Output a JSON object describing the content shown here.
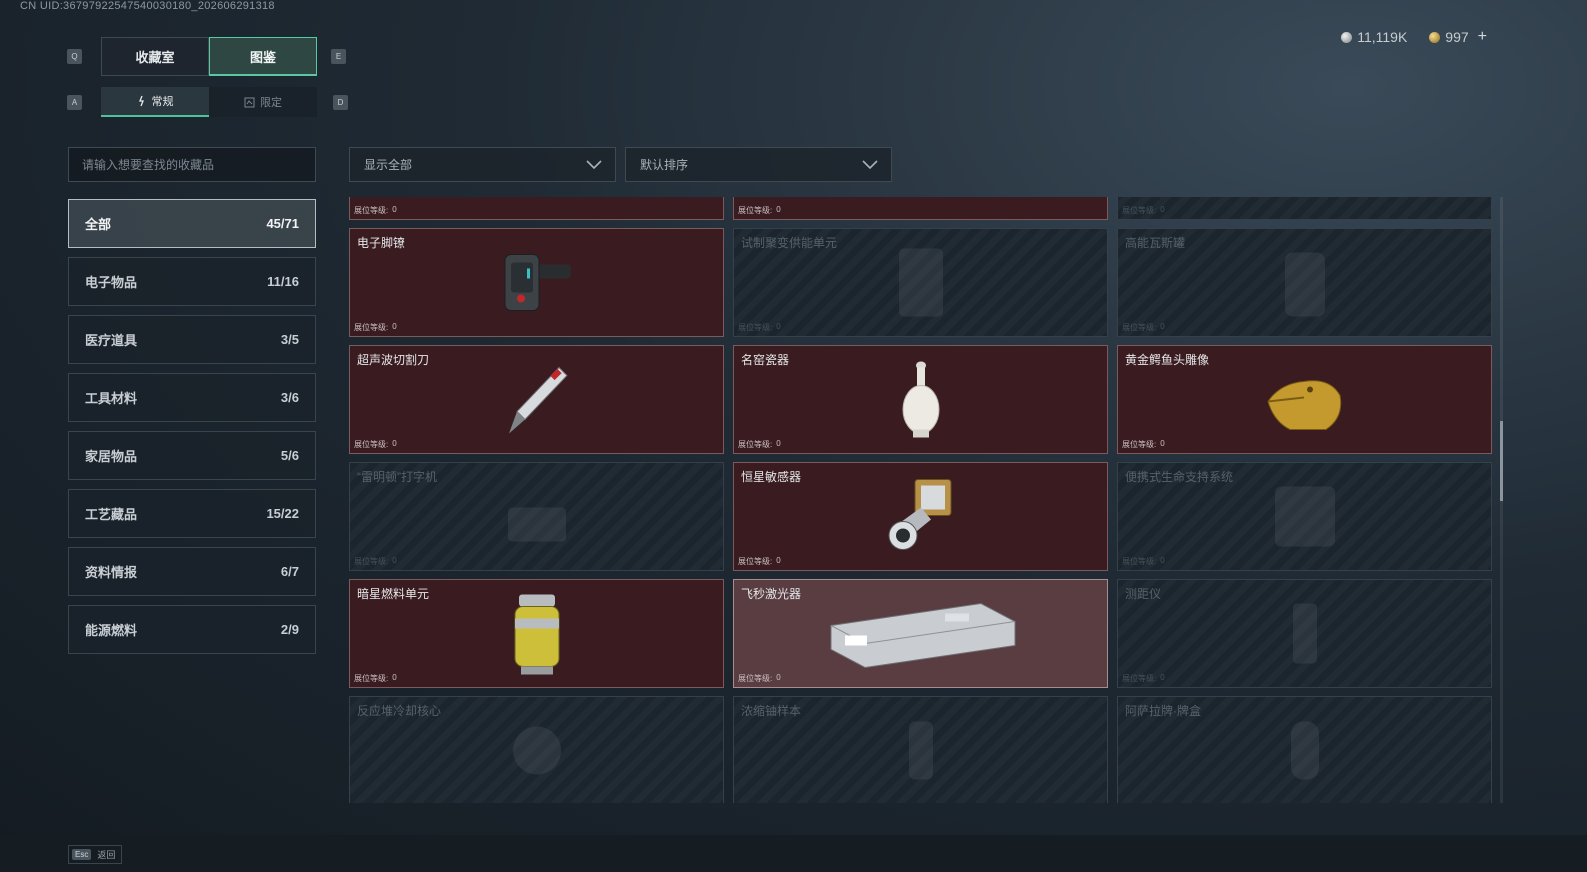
{
  "uid": "CN UID:3679792254754003018​0_202606291318",
  "currency": {
    "silver": "11,119K",
    "gold": "997",
    "plus": "+"
  },
  "keys": {
    "q": "Q",
    "e": "E",
    "a": "A",
    "d": "D"
  },
  "main_tabs": [
    "收藏室",
    "图鉴"
  ],
  "sub_tabs": [
    "常规",
    "限定"
  ],
  "search": {
    "placeholder": "请输入想要查找的收藏品"
  },
  "filter": {
    "display": "显示全部",
    "sort": "默认排序"
  },
  "categories": [
    {
      "label": "全部",
      "count": "45/71"
    },
    {
      "label": "电子物品",
      "count": "11/16"
    },
    {
      "label": "医疗道具",
      "count": "3/5"
    },
    {
      "label": "工具材料",
      "count": "3/6"
    },
    {
      "label": "家居物品",
      "count": "5/6"
    },
    {
      "label": "工艺藏品",
      "count": "15/22"
    },
    {
      "label": "资料情报",
      "count": "6/7"
    },
    {
      "label": "能源燃料",
      "count": "2/9"
    }
  ],
  "level_label": "展位等级:",
  "items": [
    {
      "name": "",
      "level": "0",
      "owned": true,
      "icon": "gold-device-icon"
    },
    {
      "name": "",
      "level": "0",
      "owned": true,
      "icon": "radio-device-icon"
    },
    {
      "name": "",
      "level": "0",
      "owned": false,
      "icon": "bronze-relic-icon"
    },
    {
      "name": "电子脚镣",
      "level": "0",
      "owned": true,
      "icon": "ankle-monitor-icon"
    },
    {
      "name": "试制聚变供能单元",
      "level": "0",
      "owned": false,
      "icon": "fusion-unit-icon"
    },
    {
      "name": "高能瓦斯罐",
      "level": "0",
      "owned": false,
      "icon": "gas-canister-icon"
    },
    {
      "name": "超声波切割刀",
      "level": "0",
      "owned": true,
      "icon": "ultrasonic-knife-icon"
    },
    {
      "name": "名窑瓷器",
      "level": "0",
      "owned": true,
      "icon": "porcelain-vase-icon"
    },
    {
      "name": "黄金鳄鱼头雕像",
      "level": "0",
      "owned": true,
      "icon": "gold-crocodile-icon"
    },
    {
      "name": "“雷明顿”打字机",
      "level": "0",
      "owned": false,
      "icon": "typewriter-icon"
    },
    {
      "name": "恒星敏感器",
      "level": "0",
      "owned": true,
      "icon": "star-sensor-icon"
    },
    {
      "name": "便携式生命支持系统",
      "level": "0",
      "owned": false,
      "icon": "life-support-icon"
    },
    {
      "name": "暗星燃料单元",
      "level": "0",
      "owned": true,
      "icon": "fuel-cell-icon"
    },
    {
      "name": "飞秒激光器",
      "level": "0",
      "owned": true,
      "highlight": true,
      "icon": "femtosecond-laser-icon"
    },
    {
      "name": "测距仪",
      "level": "0",
      "owned": false,
      "icon": "rangefinder-icon"
    },
    {
      "name": "反应堆冷却核心",
      "level": "",
      "owned": false,
      "icon": "reactor-core-icon"
    },
    {
      "name": "浓缩铀样本",
      "level": "",
      "owned": false,
      "icon": "uranium-sample-icon"
    },
    {
      "name": "阿萨拉牌·牌盒",
      "level": "",
      "owned": false,
      "icon": "card-box-icon"
    }
  ],
  "footer": {
    "esc_key": "Esc",
    "back_label": "返回"
  }
}
